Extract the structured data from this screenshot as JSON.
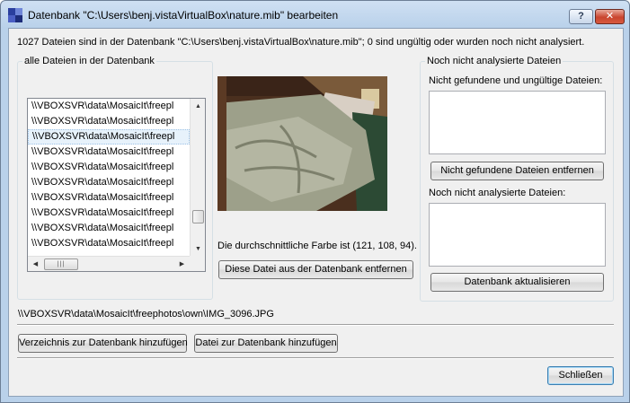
{
  "window": {
    "title": "Datenbank \"C:\\Users\\benj.vistaVirtualBox\\nature.mib\" bearbeiten",
    "help_label": "?",
    "close_label": "✕"
  },
  "summary": "1027 Dateien sind in der Datenbank \"C:\\Users\\benj.vistaVirtualBox\\nature.mib\"; 0 sind ungültig oder wurden noch nicht analysiert.",
  "all_files": {
    "group_label": "alle Dateien in der Datenbank",
    "items": [
      "\\\\VBOXSVR\\data\\MosaicIt\\freepl",
      "\\\\VBOXSVR\\data\\MosaicIt\\freepl",
      "\\\\VBOXSVR\\data\\MosaicIt\\freepl",
      "\\\\VBOXSVR\\data\\MosaicIt\\freepl",
      "\\\\VBOXSVR\\data\\MosaicIt\\freepl",
      "\\\\VBOXSVR\\data\\MosaicIt\\freepl",
      "\\\\VBOXSVR\\data\\MosaicIt\\freepl",
      "\\\\VBOXSVR\\data\\MosaicIt\\freepl",
      "\\\\VBOXSVR\\data\\MosaicIt\\freepl",
      "\\\\VBOXSVR\\data\\MosaicIt\\freepl"
    ],
    "selected_index": 2
  },
  "preview": {
    "avg_color_text": "Die durchschnittliche Farbe ist (121, 108, 94).",
    "remove_button": "Diese Datei aus der Datenbank entfernen"
  },
  "pending": {
    "group_label": "Noch nicht analysierte Dateien",
    "not_found_label": "Nicht gefundene und ungültige Dateien:",
    "remove_not_found_button": "Nicht gefundene Dateien entfernen",
    "not_analyzed_label": "Noch nicht analysierte Dateien:",
    "update_button": "Datenbank aktualisieren"
  },
  "current_path": "\\\\VBOXSVR\\data\\MosaicIt\\freephotos\\own\\IMG_3096.JPG",
  "actions": {
    "add_directory": "Verzeichnis zur Datenbank hinzufügen",
    "add_file": "Datei zur Datenbank hinzufügen",
    "close": "Schließen"
  }
}
